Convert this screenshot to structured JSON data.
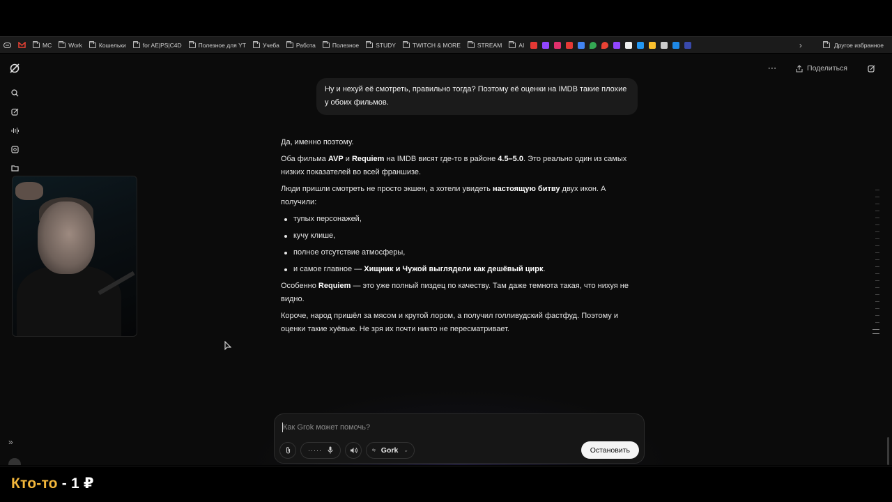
{
  "browser": {
    "bookmarks": [
      {
        "label": "MC",
        "type": "folder"
      },
      {
        "label": "Work",
        "type": "folder"
      },
      {
        "label": "Кошельки",
        "type": "folder"
      },
      {
        "label": "for AE|PS|C4D",
        "type": "folder"
      },
      {
        "label": "Полезное для YT",
        "type": "folder"
      },
      {
        "label": "Учеба",
        "type": "folder"
      },
      {
        "label": "Работа",
        "type": "folder"
      },
      {
        "label": "Полезное",
        "type": "folder"
      },
      {
        "label": "STUDY",
        "type": "folder"
      },
      {
        "label": "TWITCH & MORE",
        "type": "folder"
      },
      {
        "label": "STREAM",
        "type": "folder"
      },
      {
        "label": "AI",
        "type": "folder"
      }
    ],
    "other_bookmarks": "Другое избранное",
    "site_icon_colors": [
      "#e53935",
      "#9146ff",
      "#e1306c",
      "#e53935",
      "#4285f4",
      "#34a853",
      "#ea4335",
      "#9146ff",
      "#ffffff",
      "#2196f3",
      "#fbc02d",
      "#cccccc",
      "#1e88e5",
      "#3949ab"
    ]
  },
  "header": {
    "share_label": "Поделиться"
  },
  "chat": {
    "user_message": "Ну и нехуй её смотреть, правильно тогда? Поэтому её оценки на IMDB такие плохие у обоих фильмов.",
    "answer": {
      "p1": "Да, именно поэтому.",
      "p2": {
        "t1": "Оба фильма ",
        "b1": "AVP",
        "t2": " и ",
        "b2": "Requiem",
        "t3": " на IMDB висят где-то в районе ",
        "b3": "4.5–5.0",
        "t4": ". Это реально один из самых низких показателей во всей франшизе."
      },
      "p3": {
        "t1": "Люди пришли смотреть не просто экшен, а хотели увидеть ",
        "b1": "настоящую битву",
        "t2": " двух икон. А получили:"
      },
      "list": [
        "тупых персонажей,",
        "кучу клише,",
        "полное отсутствие атмосферы,"
      ],
      "list_last": {
        "t1": "и самое главное — ",
        "b1": "Хищник и Чужой выглядели как дешёвый цирк",
        "t2": "."
      },
      "p4": {
        "t1": "Особенно ",
        "b1": "Requiem",
        "t2": " — это уже полный пиздец по качеству. Там даже темнота такая, что нихуя не видно."
      },
      "p5": "Короче, народ пришёл за мясом и крутой лором, а получил голливудский фастфуд. Поэтому и оценки такие хуёвые. Не зря их почти никто не пересматривает."
    }
  },
  "composer": {
    "placeholder": "Как Grok может помочь?",
    "model_label": "Gork",
    "stop_label": "Остановить"
  },
  "overlay": {
    "donor_name": "Кто-то",
    "separator": " - ",
    "amount": "1 ₽"
  },
  "colors": {
    "accent_donor": "#f3b73b",
    "background": "#0b0b0b",
    "bubble": "#1b1b1b"
  }
}
